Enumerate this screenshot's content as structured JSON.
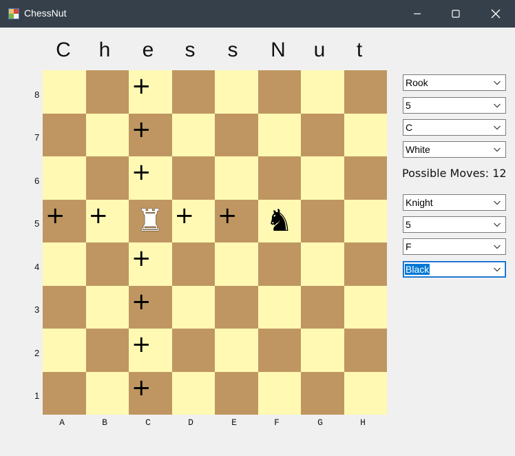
{
  "window": {
    "title": "ChessNut",
    "icons": {
      "app": "app-icon",
      "minimize": "minimize-icon",
      "maximize": "maximize-icon",
      "close": "close-icon"
    }
  },
  "heading_letters": [
    "C",
    "h",
    "e",
    "s",
    "s",
    "N",
    "u",
    "t"
  ],
  "board": {
    "ranks": [
      "8",
      "7",
      "6",
      "5",
      "4",
      "3",
      "2",
      "1"
    ],
    "files": [
      "A",
      "B",
      "C",
      "D",
      "E",
      "F",
      "G",
      "H"
    ],
    "colors": {
      "light": "#fff9b3",
      "dark": "#bf9661"
    },
    "move_marker": "+",
    "pieces": [
      {
        "square": "C5",
        "name": "white-rook",
        "glyph": "♜",
        "color": "#ffffff"
      },
      {
        "square": "F5",
        "name": "black-knight",
        "glyph": "♞",
        "color": "#000000"
      }
    ],
    "possible_move_squares": [
      "C8",
      "C7",
      "C6",
      "A5",
      "B5",
      "D5",
      "E5",
      "C4",
      "C3",
      "C2",
      "C1"
    ]
  },
  "panel": {
    "piece1": {
      "piece": "Rook",
      "rank": "5",
      "file": "C",
      "color": "White"
    },
    "possible_moves_label": "Possible Moves: 12",
    "piece2": {
      "piece": "Knight",
      "rank": "5",
      "file": "F",
      "color": "Black"
    }
  }
}
